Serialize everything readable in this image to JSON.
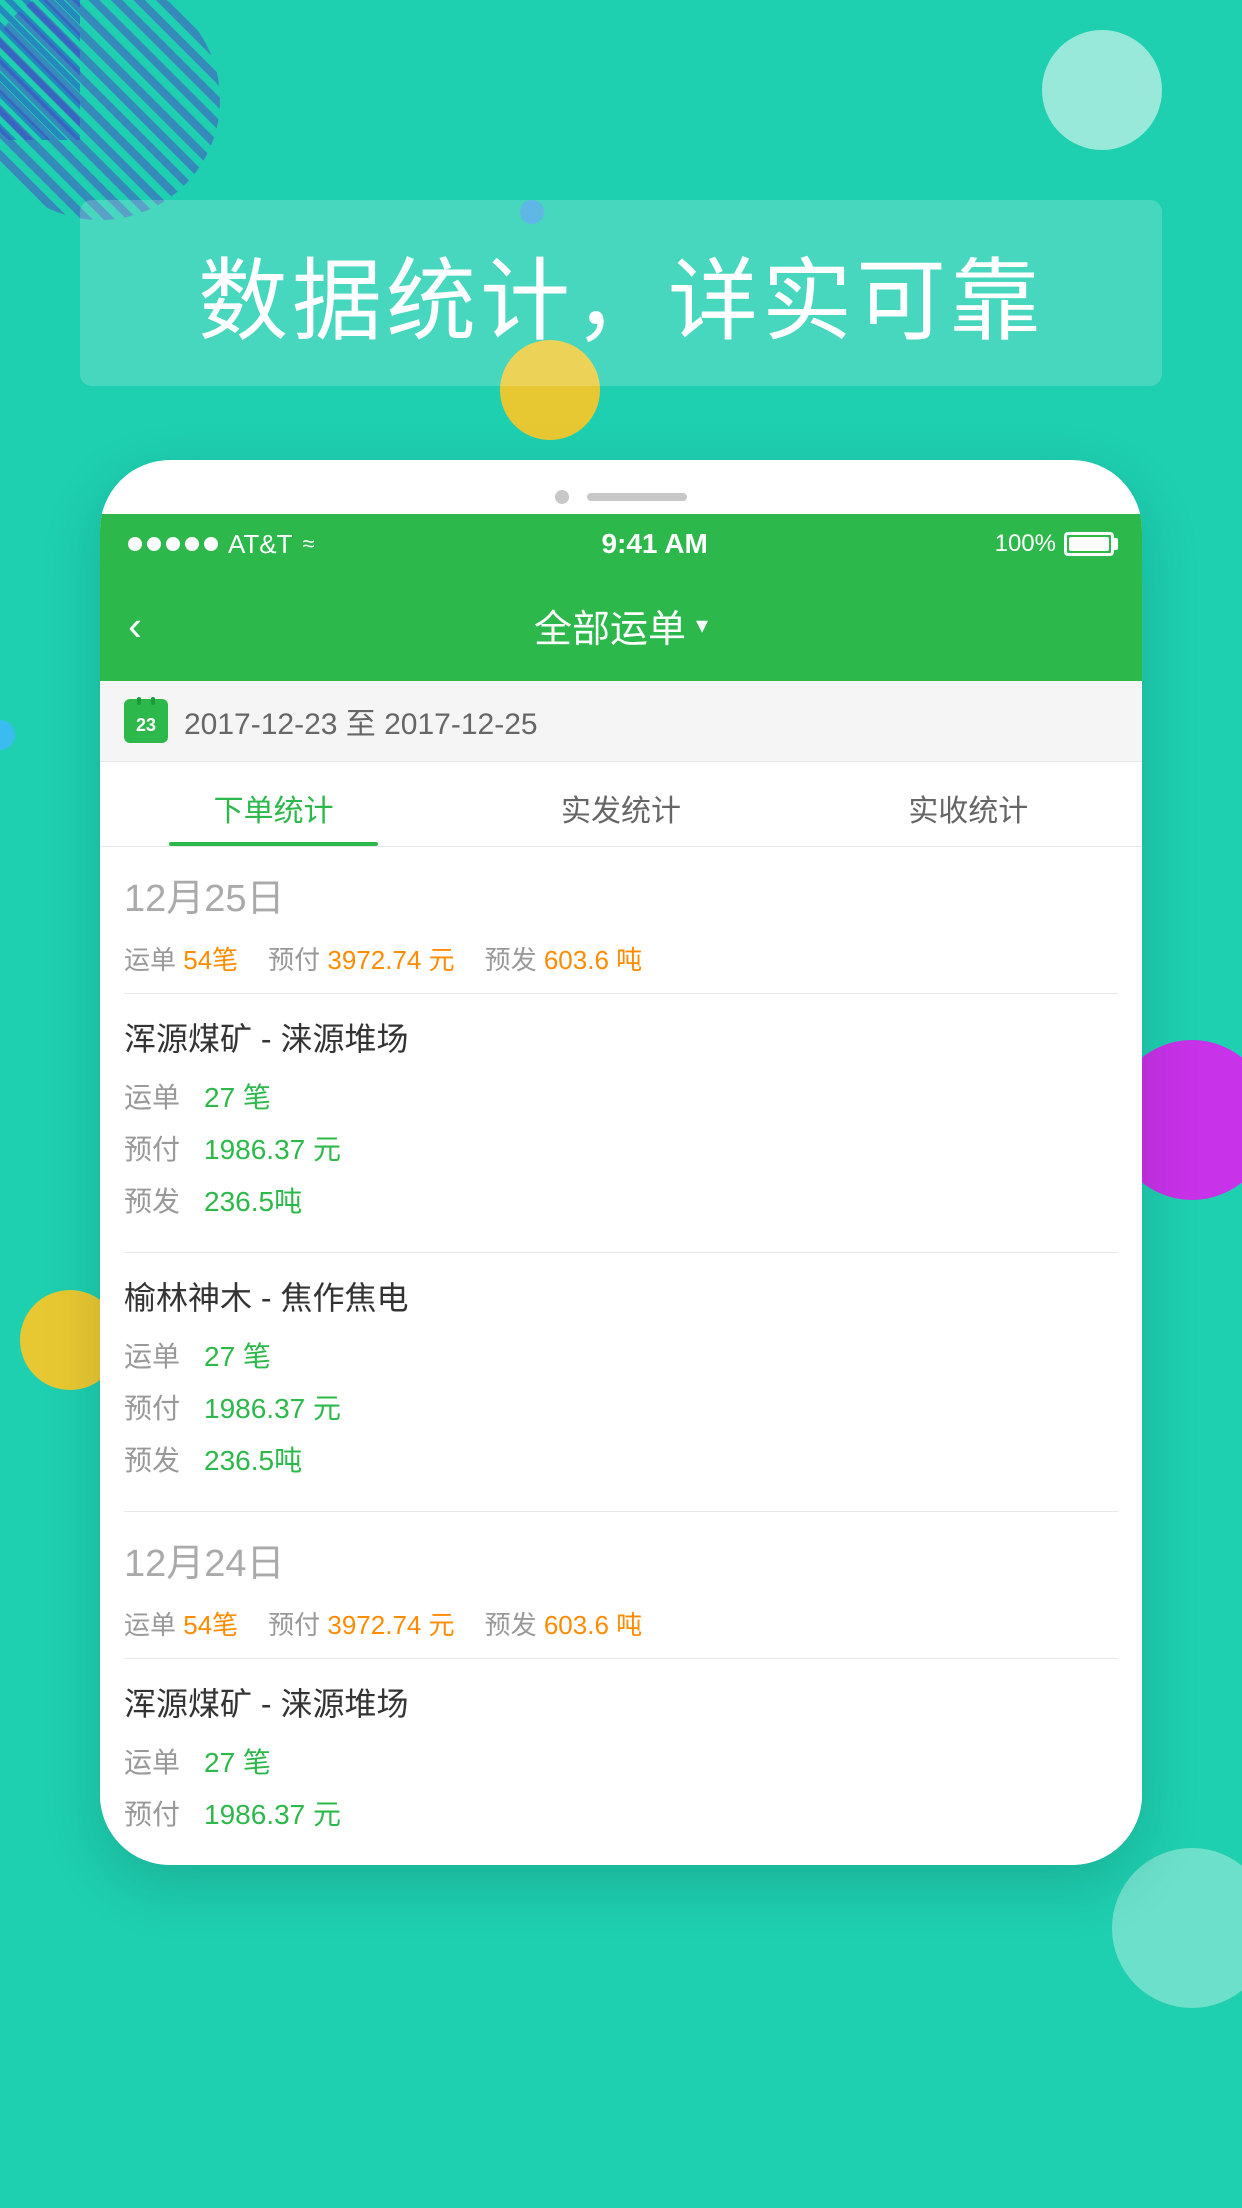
{
  "background_color": "#1ecfb0",
  "headline": {
    "text": "数据统计，详实可靠"
  },
  "status_bar": {
    "carrier": "AT&T",
    "time": "9:41 AM",
    "battery": "100%"
  },
  "nav": {
    "title": "全部运单",
    "back_label": "‹"
  },
  "date_range": {
    "start": "2017-12-23",
    "end": "2017-12-25",
    "display": "2017-12-23 至 2017-12-25"
  },
  "tabs": [
    {
      "label": "下单统计",
      "active": true
    },
    {
      "label": "实发统计",
      "active": false
    },
    {
      "label": "实收统计",
      "active": false
    }
  ],
  "sections": [
    {
      "date": "12月25日",
      "summary": {
        "orders": "54笔",
        "prepay": "3972.74 元",
        "presend": "603.6 吨"
      },
      "routes": [
        {
          "name": "浑源煤矿 - 涞源堆场",
          "orders": "27 笔",
          "prepay": "1986.37 元",
          "presend": "236.5吨"
        },
        {
          "name": "榆林神木 - 焦作焦电",
          "orders": "27 笔",
          "prepay": "1986.37 元",
          "presend": "236.5吨"
        }
      ]
    },
    {
      "date": "12月24日",
      "summary": {
        "orders": "54笔",
        "prepay": "3972.74 元",
        "presend": "603.6 吨"
      },
      "routes": [
        {
          "name": "浑源煤矿 - 涞源堆场",
          "orders": "27 笔",
          "prepay": "1986.37 元",
          "presend": ""
        }
      ]
    }
  ],
  "labels": {
    "orders": "运单",
    "prepay": "预付",
    "presend": "预发",
    "order_unit": "笔",
    "money_unit": "元",
    "weight_unit": "吨"
  }
}
